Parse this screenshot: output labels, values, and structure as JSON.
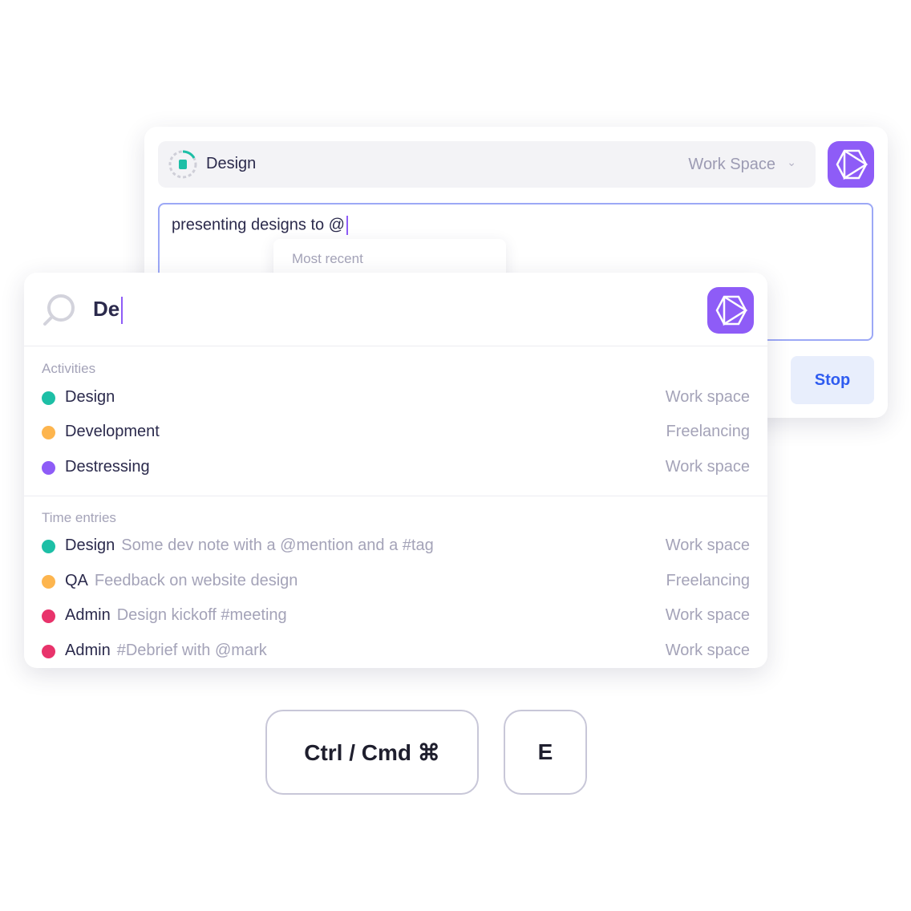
{
  "tracker": {
    "activity": "Design",
    "workspace": "Work Space",
    "note_value": "presenting designs to @",
    "mention_dropdown_label": "Most recent",
    "stop_label": "Stop",
    "colors": {
      "accent": "#8e5cf7",
      "stop_text": "#2f5cf0"
    }
  },
  "search": {
    "query": "De",
    "activities_label": "Activities",
    "activities": [
      {
        "name": "Design",
        "workspace": "Work space",
        "color": "#1dbfa6"
      },
      {
        "name": "Development",
        "workspace": "Freelancing",
        "color": "#fdb54e"
      },
      {
        "name": "Destressing",
        "workspace": "Work space",
        "color": "#8e5cf7"
      }
    ],
    "time_entries_label": "Time entries",
    "time_entries": [
      {
        "name": "Design",
        "note": "Some dev note with a @mention and a #tag",
        "workspace": "Work space",
        "color": "#1dbfa6"
      },
      {
        "name": "QA",
        "note": "Feedback on website design",
        "workspace": "Freelancing",
        "color": "#fdb54e"
      },
      {
        "name": "Admin",
        "note": "Design kickoff #meeting",
        "workspace": "Work space",
        "color": "#e8336b"
      },
      {
        "name": "Admin",
        "note": "#Debrief with @mark",
        "workspace": "Work space",
        "color": "#e8336b"
      }
    ]
  },
  "shortcut": {
    "key1": "Ctrl / Cmd ⌘",
    "key2": "E"
  }
}
